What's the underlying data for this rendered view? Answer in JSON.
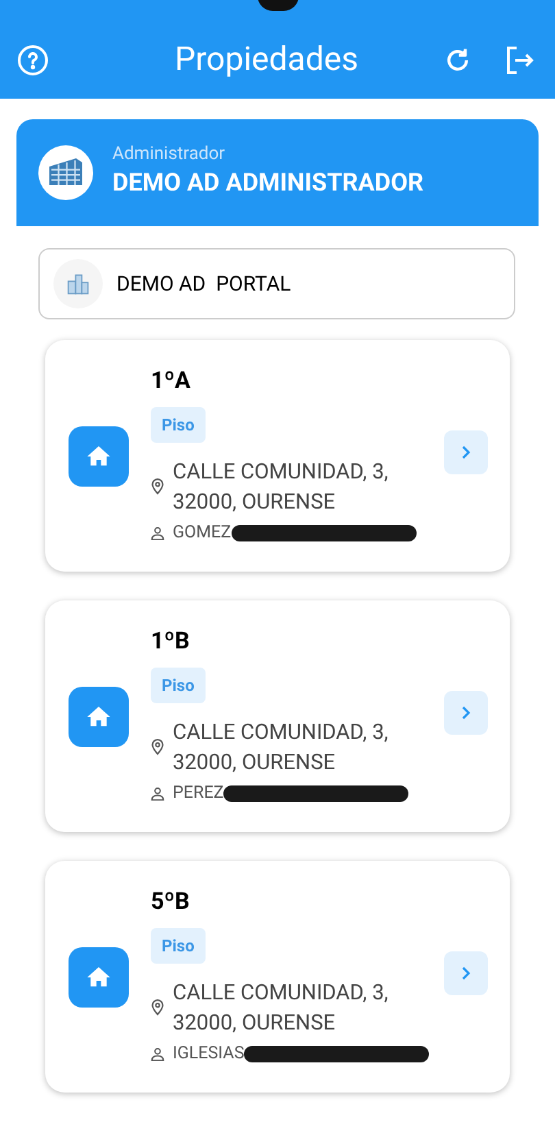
{
  "app_bar": {
    "title": "Propiedades"
  },
  "account": {
    "role": "Administrador",
    "name": "DEMO AD ADMINISTRADOR"
  },
  "community": {
    "name": "DEMO AD  PORTAL"
  },
  "properties": [
    {
      "unit": "1ºA",
      "type": "Piso",
      "address": "CALLE COMUNIDAD, 3, 32000, OURENSE",
      "owner": "GOMEZ"
    },
    {
      "unit": "1ºB",
      "type": "Piso",
      "address": "CALLE COMUNIDAD, 3, 32000, OURENSE",
      "owner": "PEREZ"
    },
    {
      "unit": "5ºB",
      "type": "Piso",
      "address": "CALLE COMUNIDAD, 3, 32000, OURENSE",
      "owner": "IGLESIAS"
    }
  ]
}
